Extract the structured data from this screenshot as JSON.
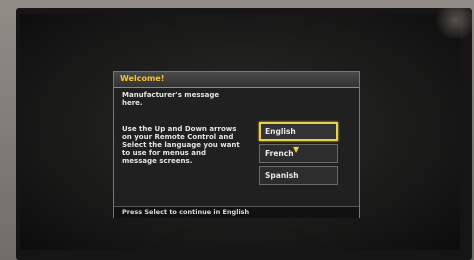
{
  "dialog": {
    "title": "Welcome!",
    "message_lines": [
      "Manufacturer's message",
      "here."
    ],
    "instruction_lines": [
      "Use the Up and Down arrows",
      "on your Remote Control and",
      "Select the language you want",
      "to use for menus and",
      "message screens."
    ],
    "languages": [
      {
        "label": "English",
        "selected": true
      },
      {
        "label": "French",
        "selected": false
      },
      {
        "label": "Spanish",
        "selected": false
      }
    ],
    "footer": "Press Select to continue in English"
  },
  "colors": {
    "title": "#f2c233",
    "selection_border": "#e8d04a",
    "dialog_bg": "#202020",
    "text": "#e4e4e4"
  },
  "icons": {
    "selection_arrow": "chevron-down-icon"
  }
}
